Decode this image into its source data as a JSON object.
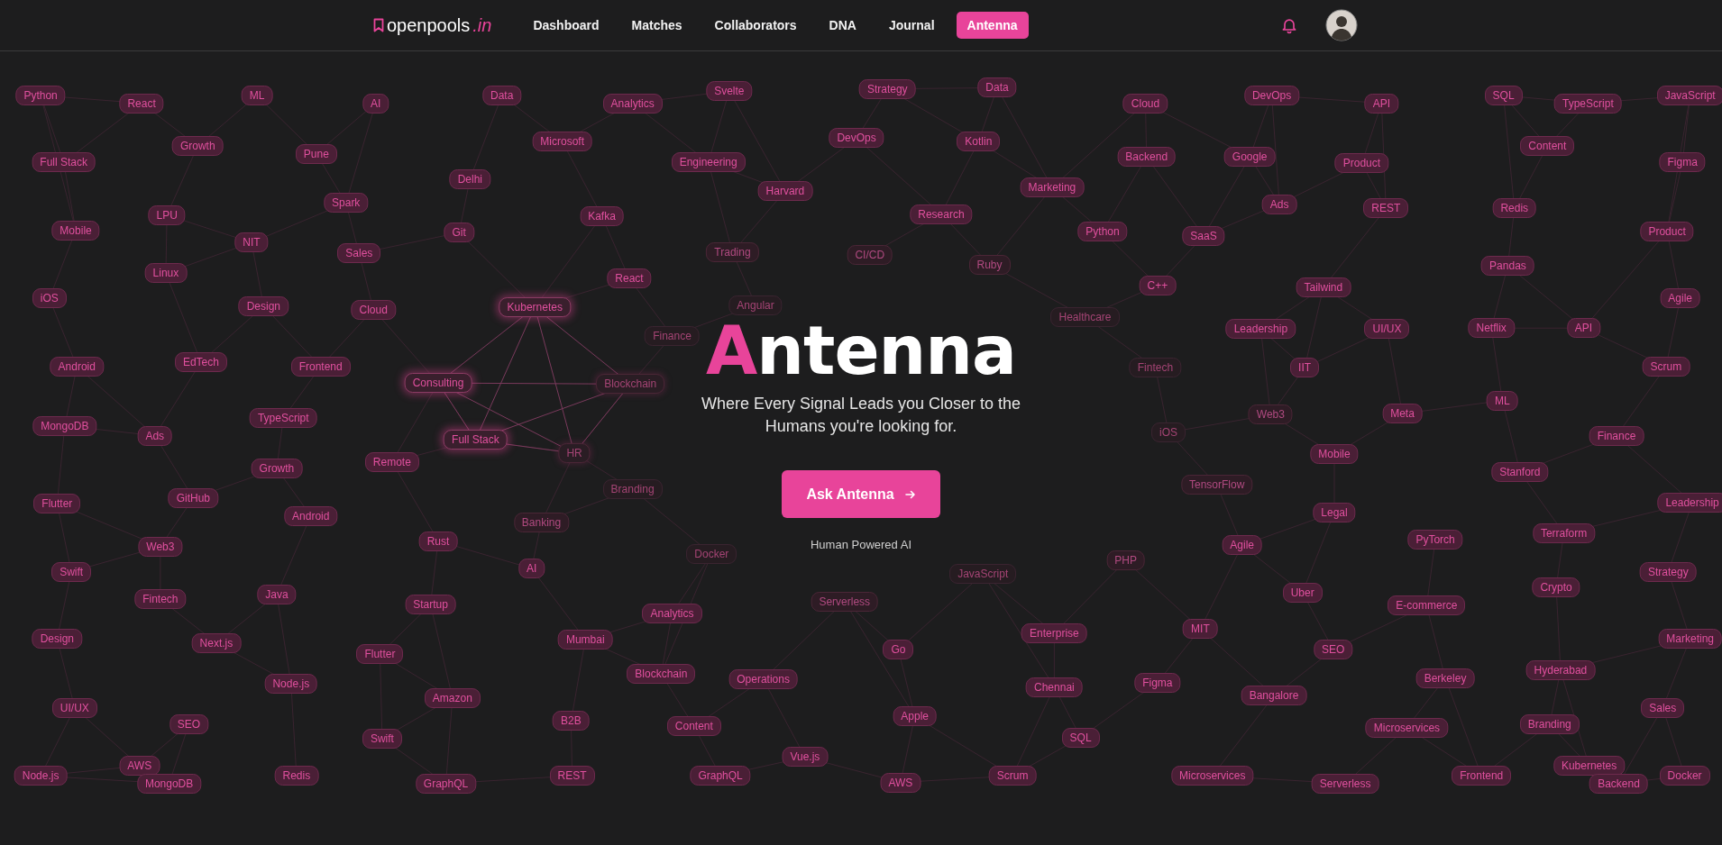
{
  "header": {
    "logo": {
      "name": "openpools",
      "suffix": ".in"
    },
    "nav": [
      {
        "label": "Dashboard",
        "selected": false
      },
      {
        "label": "Matches",
        "selected": false
      },
      {
        "label": "Collaborators",
        "selected": false
      },
      {
        "label": "DNA",
        "selected": false
      },
      {
        "label": "Journal",
        "selected": false
      },
      {
        "label": "Antenna",
        "selected": true
      }
    ]
  },
  "hero": {
    "title": {
      "accent": "A",
      "rest": "ntenna"
    },
    "subtitle": "Where Every Signal Leads you Closer to the Humans you're looking for.",
    "button": "Ask Antenna",
    "caption": "Human Powered AI"
  },
  "tags": [
    {
      "label": "Python",
      "kind": "normal"
    },
    {
      "label": "React",
      "kind": "normal"
    },
    {
      "label": "ML",
      "kind": "normal"
    },
    {
      "label": "AI",
      "kind": "normal"
    },
    {
      "label": "Data",
      "kind": "normal"
    },
    {
      "label": "Analytics",
      "kind": "normal"
    },
    {
      "label": "Svelte",
      "kind": "normal"
    },
    {
      "label": "Strategy",
      "kind": "normal"
    },
    {
      "label": "Data",
      "kind": "normal"
    },
    {
      "label": "Cloud",
      "kind": "normal"
    },
    {
      "label": "DevOps",
      "kind": "normal"
    },
    {
      "label": "API",
      "kind": "normal"
    },
    {
      "label": "SQL",
      "kind": "normal"
    },
    {
      "label": "TypeScript",
      "kind": "normal"
    },
    {
      "label": "JavaScript",
      "kind": "normal"
    },
    {
      "label": "Full Stack",
      "kind": "normal"
    },
    {
      "label": "Growth",
      "kind": "normal"
    },
    {
      "label": "Pune",
      "kind": "normal"
    },
    {
      "label": "Microsoft",
      "kind": "normal"
    },
    {
      "label": "Engineering",
      "kind": "normal"
    },
    {
      "label": "DevOps",
      "kind": "normal"
    },
    {
      "label": "Kotlin",
      "kind": "normal"
    },
    {
      "label": "Backend",
      "kind": "normal"
    },
    {
      "label": "Google",
      "kind": "normal"
    },
    {
      "label": "Product",
      "kind": "normal"
    },
    {
      "label": "Content",
      "kind": "normal"
    },
    {
      "label": "Figma",
      "kind": "normal"
    },
    {
      "label": "Delhi",
      "kind": "normal"
    },
    {
      "label": "Harvard",
      "kind": "normal"
    },
    {
      "label": "Marketing",
      "kind": "normal"
    },
    {
      "label": "LPU",
      "kind": "normal"
    },
    {
      "label": "Spark",
      "kind": "normal"
    },
    {
      "label": "Kafka",
      "kind": "normal"
    },
    {
      "label": "Research",
      "kind": "normal"
    },
    {
      "label": "Ads",
      "kind": "normal"
    },
    {
      "label": "REST",
      "kind": "normal"
    },
    {
      "label": "Redis",
      "kind": "normal"
    },
    {
      "label": "Mobile",
      "kind": "normal"
    },
    {
      "label": "NIT",
      "kind": "normal"
    },
    {
      "label": "Git",
      "kind": "normal"
    },
    {
      "label": "Python",
      "kind": "normal"
    },
    {
      "label": "SaaS",
      "kind": "normal"
    },
    {
      "label": "Product",
      "kind": "normal"
    },
    {
      "label": "Linux",
      "kind": "normal"
    },
    {
      "label": "Sales",
      "kind": "normal"
    },
    {
      "label": "React",
      "kind": "normal"
    },
    {
      "label": "Trading",
      "kind": "dim"
    },
    {
      "label": "CI/CD",
      "kind": "dim"
    },
    {
      "label": "Ruby",
      "kind": "dim"
    },
    {
      "label": "C++",
      "kind": "normal"
    },
    {
      "label": "Tailwind",
      "kind": "normal"
    },
    {
      "label": "Pandas",
      "kind": "normal"
    },
    {
      "label": "iOS",
      "kind": "normal"
    },
    {
      "label": "Design",
      "kind": "normal"
    },
    {
      "label": "Cloud",
      "kind": "normal"
    },
    {
      "label": "Kubernetes",
      "kind": "glow"
    },
    {
      "label": "Finance",
      "kind": "faint"
    },
    {
      "label": "Angular",
      "kind": "faint"
    },
    {
      "label": "Healthcare",
      "kind": "faint"
    },
    {
      "label": "Leadership",
      "kind": "normal"
    },
    {
      "label": "UI/UX",
      "kind": "normal"
    },
    {
      "label": "Netflix",
      "kind": "normal"
    },
    {
      "label": "API",
      "kind": "normal"
    },
    {
      "label": "Agile",
      "kind": "normal"
    },
    {
      "label": "Android",
      "kind": "normal"
    },
    {
      "label": "EdTech",
      "kind": "normal"
    },
    {
      "label": "Frontend",
      "kind": "normal"
    },
    {
      "label": "Consulting",
      "kind": "glow"
    },
    {
      "label": "Blockchain",
      "kind": "ember"
    },
    {
      "label": "Fintech",
      "kind": "faint"
    },
    {
      "label": "IIT",
      "kind": "normal"
    },
    {
      "label": "Scrum",
      "kind": "normal"
    },
    {
      "label": "MongoDB",
      "kind": "normal"
    },
    {
      "label": "Ads",
      "kind": "normal"
    },
    {
      "label": "TypeScript",
      "kind": "normal"
    },
    {
      "label": "Full Stack",
      "kind": "glow"
    },
    {
      "label": "iOS",
      "kind": "faint"
    },
    {
      "label": "Web3",
      "kind": "dim"
    },
    {
      "label": "Meta",
      "kind": "normal"
    },
    {
      "label": "ML",
      "kind": "normal"
    },
    {
      "label": "Finance",
      "kind": "normal"
    },
    {
      "label": "Growth",
      "kind": "normal"
    },
    {
      "label": "Remote",
      "kind": "normal"
    },
    {
      "label": "HR",
      "kind": "ember"
    },
    {
      "label": "Mobile",
      "kind": "normal"
    },
    {
      "label": "Stanford",
      "kind": "normal"
    },
    {
      "label": "Flutter",
      "kind": "normal"
    },
    {
      "label": "GitHub",
      "kind": "normal"
    },
    {
      "label": "Android",
      "kind": "normal"
    },
    {
      "label": "Banking",
      "kind": "dim"
    },
    {
      "label": "Branding",
      "kind": "faint"
    },
    {
      "label": "TensorFlow",
      "kind": "dim"
    },
    {
      "label": "Legal",
      "kind": "normal"
    },
    {
      "label": "Leadership",
      "kind": "normal"
    },
    {
      "label": "Web3",
      "kind": "normal"
    },
    {
      "label": "Rust",
      "kind": "normal"
    },
    {
      "label": "Docker",
      "kind": "faint"
    },
    {
      "label": "Agile",
      "kind": "normal"
    },
    {
      "label": "PyTorch",
      "kind": "normal"
    },
    {
      "label": "Terraform",
      "kind": "normal"
    },
    {
      "label": "Swift",
      "kind": "normal"
    },
    {
      "label": "AI",
      "kind": "normal"
    },
    {
      "label": "JavaScript",
      "kind": "faint"
    },
    {
      "label": "PHP",
      "kind": "dim"
    },
    {
      "label": "Strategy",
      "kind": "normal"
    },
    {
      "label": "Fintech",
      "kind": "normal"
    },
    {
      "label": "Java",
      "kind": "normal"
    },
    {
      "label": "Startup",
      "kind": "normal"
    },
    {
      "label": "Analytics",
      "kind": "normal"
    },
    {
      "label": "Serverless",
      "kind": "dim"
    },
    {
      "label": "Uber",
      "kind": "normal"
    },
    {
      "label": "E-commerce",
      "kind": "normal"
    },
    {
      "label": "Crypto",
      "kind": "normal"
    },
    {
      "label": "Design",
      "kind": "normal"
    },
    {
      "label": "Next.js",
      "kind": "normal"
    },
    {
      "label": "Flutter",
      "kind": "normal"
    },
    {
      "label": "Mumbai",
      "kind": "normal"
    },
    {
      "label": "Go",
      "kind": "normal"
    },
    {
      "label": "Enterprise",
      "kind": "normal"
    },
    {
      "label": "MIT",
      "kind": "normal"
    },
    {
      "label": "SEO",
      "kind": "normal"
    },
    {
      "label": "Marketing",
      "kind": "normal"
    },
    {
      "label": "Node.js",
      "kind": "normal"
    },
    {
      "label": "Amazon",
      "kind": "normal"
    },
    {
      "label": "Blockchain",
      "kind": "normal"
    },
    {
      "label": "Operations",
      "kind": "normal"
    },
    {
      "label": "Chennai",
      "kind": "normal"
    },
    {
      "label": "Figma",
      "kind": "normal"
    },
    {
      "label": "Bangalore",
      "kind": "normal"
    },
    {
      "label": "Berkeley",
      "kind": "normal"
    },
    {
      "label": "Hyderabad",
      "kind": "normal"
    },
    {
      "label": "UI/UX",
      "kind": "normal"
    },
    {
      "label": "SEO",
      "kind": "normal"
    },
    {
      "label": "Swift",
      "kind": "normal"
    },
    {
      "label": "B2B",
      "kind": "normal"
    },
    {
      "label": "Content",
      "kind": "normal"
    },
    {
      "label": "Apple",
      "kind": "normal"
    },
    {
      "label": "SQL",
      "kind": "normal"
    },
    {
      "label": "Microservices",
      "kind": "normal"
    },
    {
      "label": "Branding",
      "kind": "normal"
    },
    {
      "label": "Sales",
      "kind": "normal"
    },
    {
      "label": "Node.js",
      "kind": "normal"
    },
    {
      "label": "AWS",
      "kind": "normal"
    },
    {
      "label": "MongoDB",
      "kind": "normal"
    },
    {
      "label": "Redis",
      "kind": "normal"
    },
    {
      "label": "GraphQL",
      "kind": "normal"
    },
    {
      "label": "REST",
      "kind": "normal"
    },
    {
      "label": "GraphQL",
      "kind": "normal"
    },
    {
      "label": "Vue.js",
      "kind": "normal"
    },
    {
      "label": "AWS",
      "kind": "normal"
    },
    {
      "label": "Scrum",
      "kind": "normal"
    },
    {
      "label": "Microservices",
      "kind": "normal"
    },
    {
      "label": "Serverless",
      "kind": "normal"
    },
    {
      "label": "Frontend",
      "kind": "normal"
    },
    {
      "label": "Kubernetes",
      "kind": "normal"
    },
    {
      "label": "Backend",
      "kind": "normal"
    },
    {
      "label": "Docker",
      "kind": "normal"
    }
  ]
}
